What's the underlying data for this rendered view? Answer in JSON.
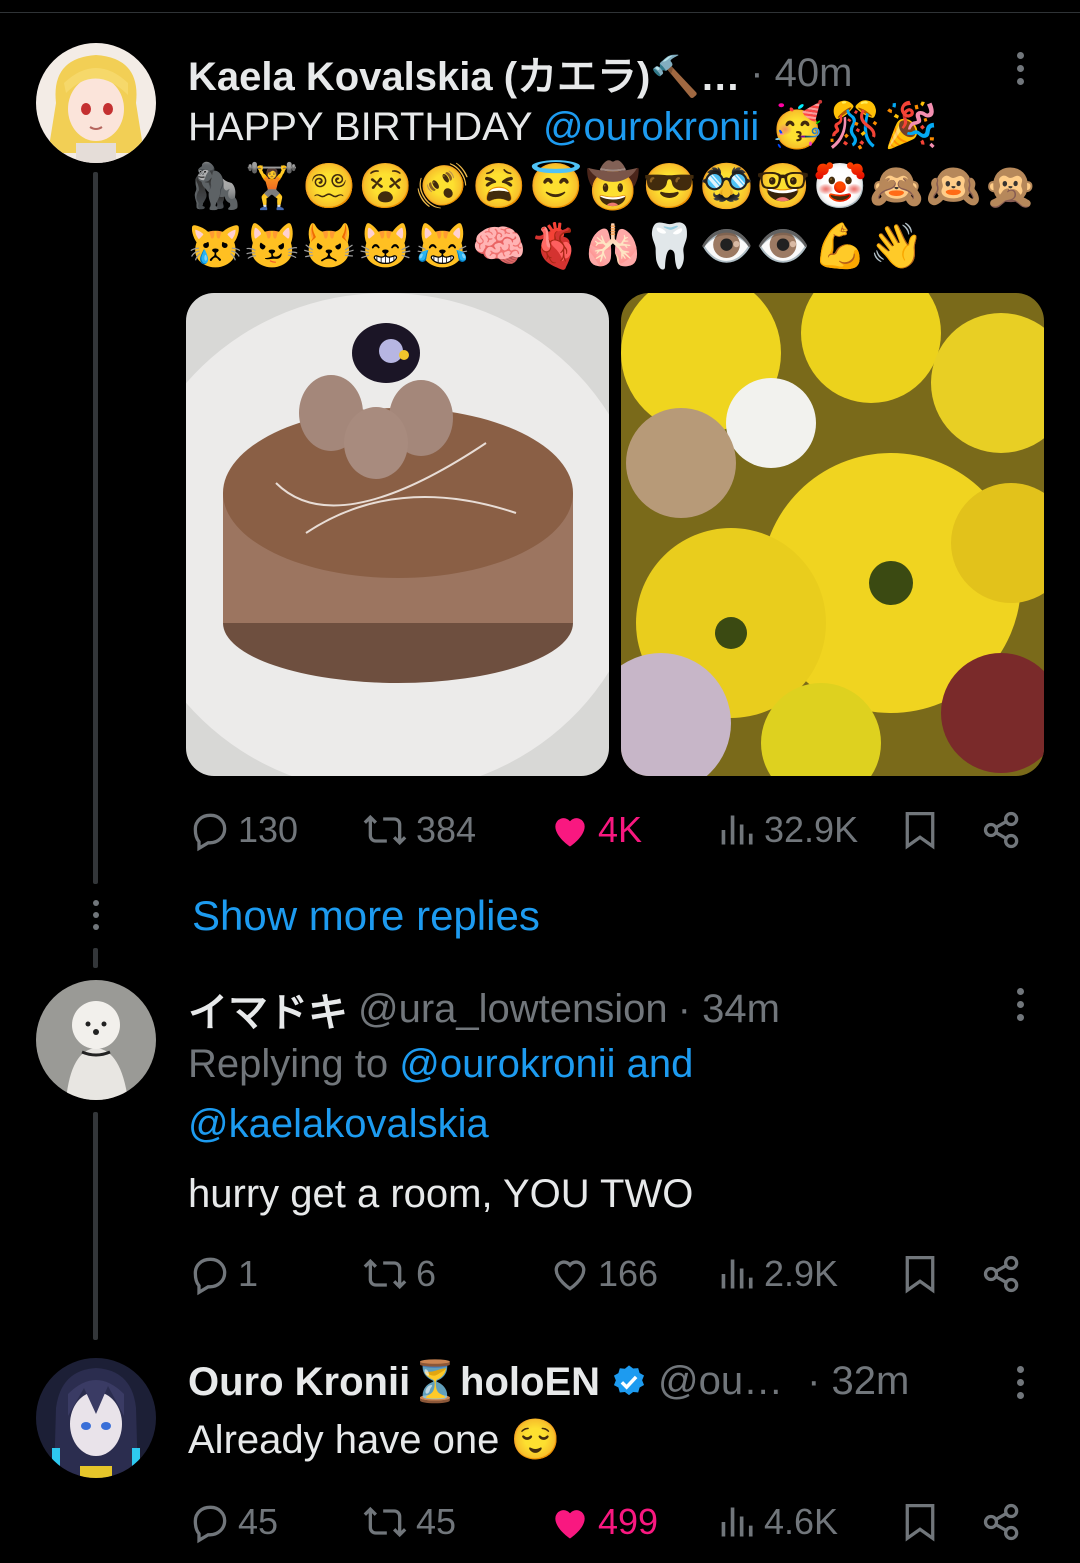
{
  "tweet1": {
    "name": "Kaela Kovalskia (カエラ)",
    "name_suffix": "🔨…",
    "time": "· 40m",
    "text_prefix": "HAPPY BIRTHDAY ",
    "mention": "@ourokronii",
    "emoji_line1": "🥳🎊🎉",
    "emoji_line2": "🦍🏋️😵‍💫😵🫨😫😇🤠😎🥸🤓🤡🙈🙉🙊🙀",
    "emoji_line3": "😿😼😾😸😹🧠🫀🫁🦷👁️👁️💪👋",
    "images": [
      "chocolate-mousse-cake",
      "yellow-chrysanthemums"
    ],
    "replies": "130",
    "reposts": "384",
    "likes": "4K",
    "views": "32.9K"
  },
  "show_more": "Show more replies",
  "tweet2": {
    "name": "イマドキ",
    "handle": "@ura_lowtension",
    "time": "· 34m",
    "replying_prefix": "Replying to ",
    "replying_mention1": "@ourokronii",
    "replying_and": " and",
    "replying_mention2": "@kaelakovalskia",
    "text": "hurry get a room, YOU TWO",
    "replies": "1",
    "reposts": "6",
    "likes": "166",
    "views": "2.9K"
  },
  "tweet3": {
    "name": "Ouro Kronii",
    "name_mid": "⏳",
    "name_suffix": "holoEN",
    "handle": "@ou…",
    "time": "· 32m",
    "text": "Already have one ",
    "text_emoji": "😌",
    "replies": "45",
    "reposts": "45",
    "likes": "499",
    "views": "4.6K"
  },
  "colors": {
    "background": "#000000",
    "text": "#e7e9ea",
    "muted": "#71767b",
    "link": "#1d9bf0",
    "like": "#f91880",
    "verified": "#1d9bf0"
  }
}
